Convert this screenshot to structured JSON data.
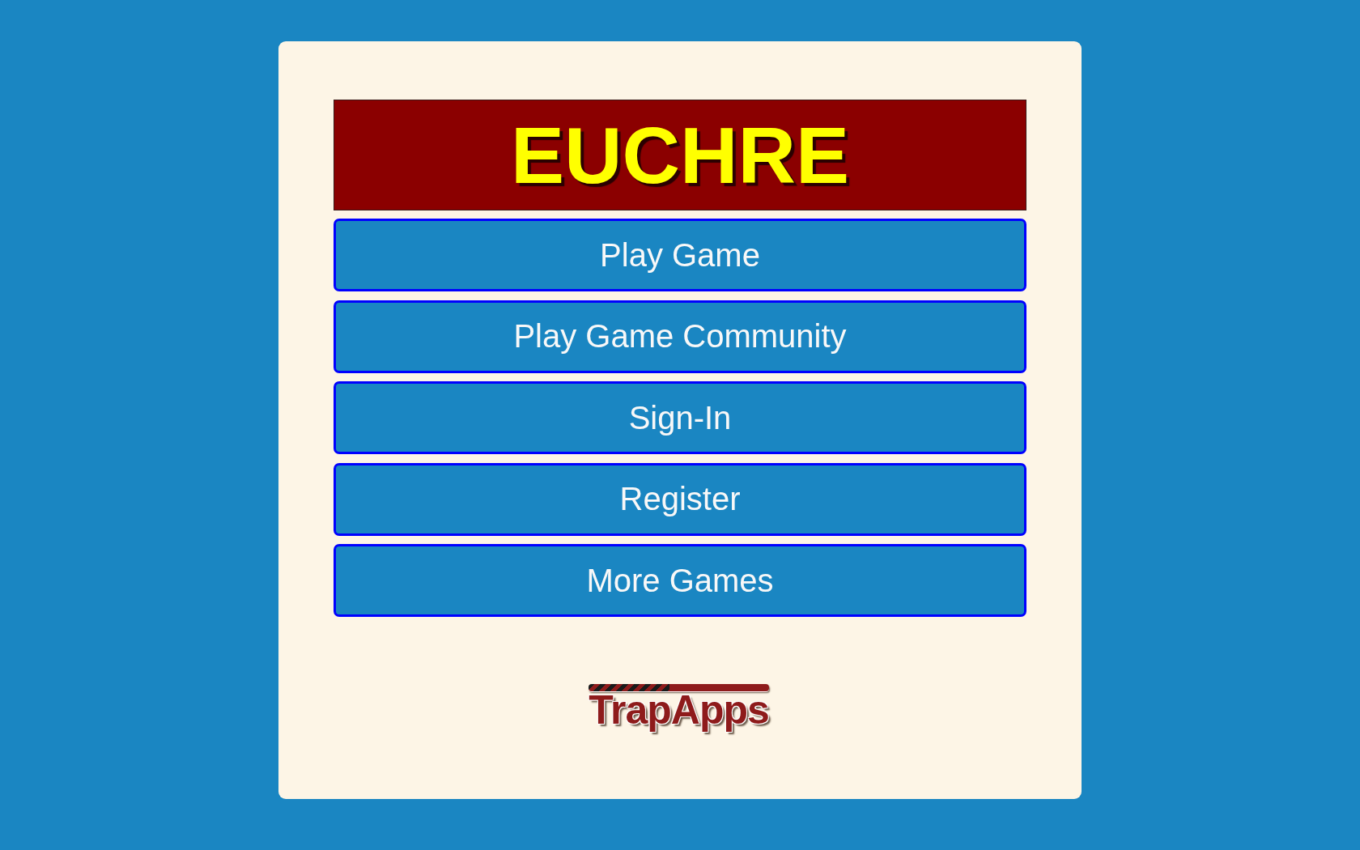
{
  "title": "EUCHRE",
  "menu": [
    {
      "label": "Play Game"
    },
    {
      "label": "Play Game Community"
    },
    {
      "label": "Sign-In"
    },
    {
      "label": "Register"
    },
    {
      "label": "More Games"
    }
  ],
  "footer": {
    "logo": "TrapApps"
  }
}
